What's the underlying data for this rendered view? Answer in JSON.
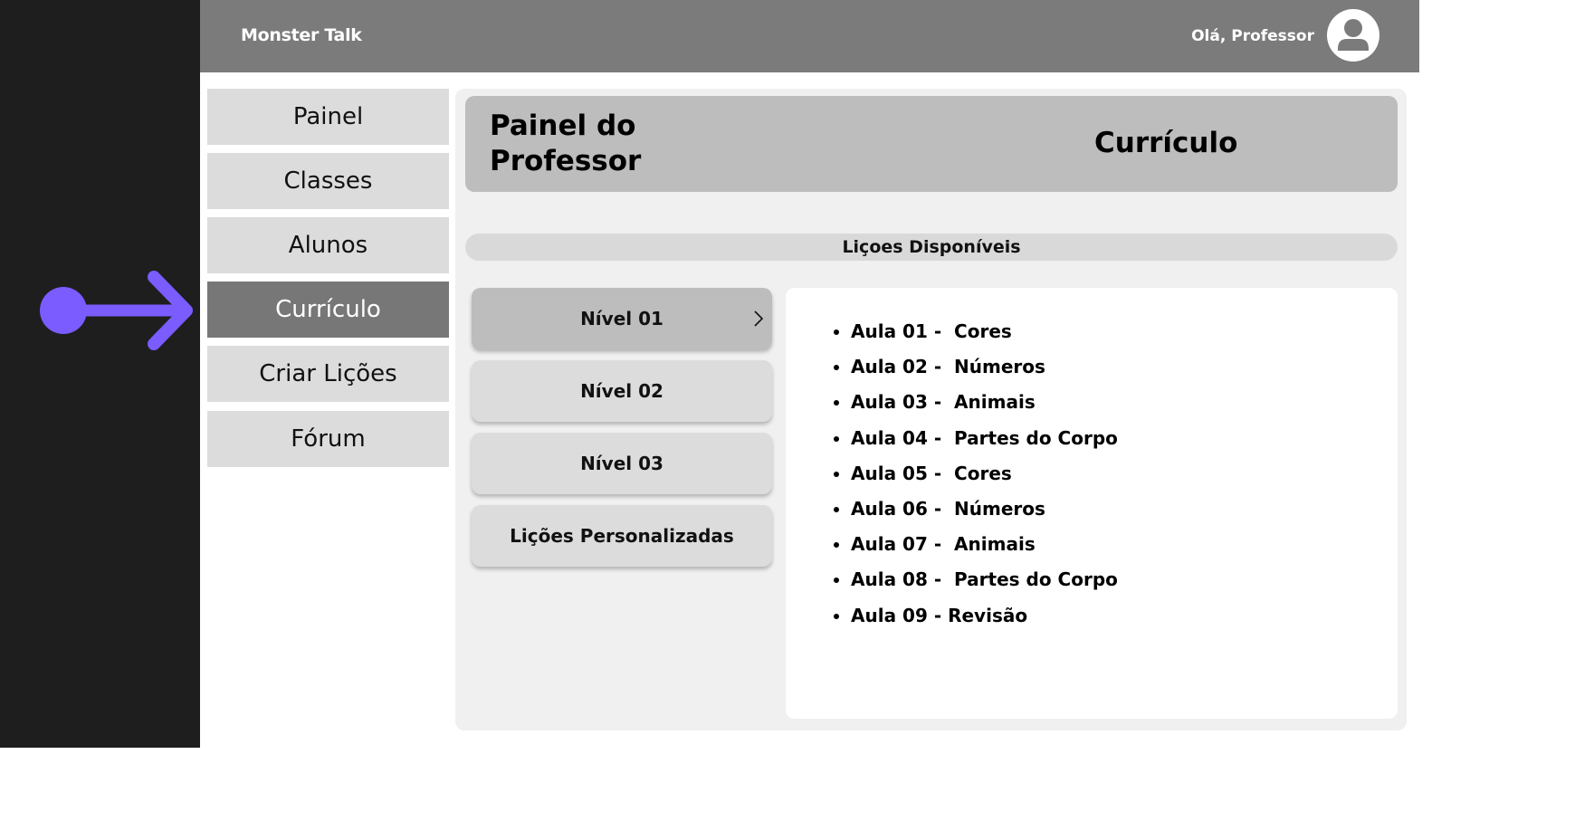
{
  "app": {
    "brand": "Monster Talk",
    "greeting": "Olá, Professor"
  },
  "icons": {
    "avatar": "user-avatar-icon",
    "arrow": "pointer-arrow-icon",
    "chevron": "chevron-right-icon"
  },
  "colors": {
    "accent": "#7a5cff",
    "sidebar_active": "#777777",
    "topbar": "#7b7b7b",
    "left_strip": "#1e1e1e"
  },
  "sidebar": {
    "items": [
      {
        "label": "Painel",
        "active": false
      },
      {
        "label": "Classes",
        "active": false
      },
      {
        "label": "Alunos",
        "active": false
      },
      {
        "label": "Currículo",
        "active": true
      },
      {
        "label": "Criar Lições",
        "active": false
      },
      {
        "label": "Fórum",
        "active": false
      }
    ]
  },
  "header": {
    "title": "Painel do Professor",
    "section": "Currículo"
  },
  "lessons": {
    "heading": "Liçoes Disponíveis",
    "levels": [
      {
        "label": "Nível 01",
        "active": true
      },
      {
        "label": "Nível 02",
        "active": false
      },
      {
        "label": "Nível 03",
        "active": false
      },
      {
        "label": "Lições Personalizadas",
        "active": false
      }
    ],
    "items": [
      "Aula 01 -  Cores",
      "Aula 02 -  Números",
      "Aula 03 -  Animais",
      "Aula 04 -  Partes do Corpo",
      "Aula 05 -  Cores",
      "Aula 06 -  Números",
      "Aula 07 -  Animais",
      "Aula 08 -  Partes do Corpo",
      "Aula 09 - Revisão"
    ]
  }
}
